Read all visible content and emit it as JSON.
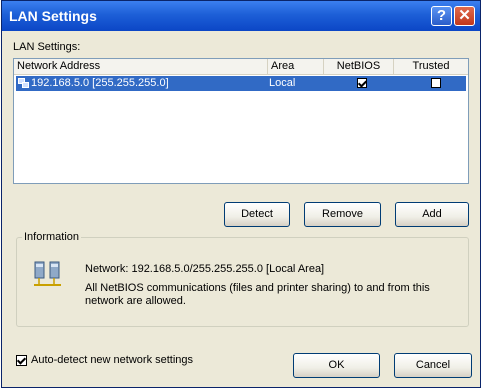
{
  "window": {
    "title": "LAN Settings"
  },
  "lan_settings_label": "LAN Settings:",
  "list": {
    "columns": [
      "Network Address",
      "Area",
      "NetBIOS",
      "Trusted"
    ],
    "rows": [
      {
        "address": "192.168.5.0 [255.255.255.0]",
        "area": "Local",
        "netbios": true,
        "trusted": false
      }
    ]
  },
  "buttons": {
    "detect": "Detect",
    "remove": "Remove",
    "add": "Add",
    "ok": "OK",
    "cancel": "Cancel"
  },
  "information": {
    "legend": "Information",
    "network_text": "Network: 192.168.5.0/255.255.255.0 [Local Area]",
    "netbios_text": "All NetBIOS communications (files and printer sharing) to and from this network are allowed."
  },
  "auto_detect": {
    "label": "Auto-detect new network settings",
    "checked": true
  },
  "icons": [
    "network-icon",
    "help-icon",
    "close-icon",
    "computers-icon"
  ],
  "colors": {
    "titlebar": "#0b46c6",
    "selection": "#316ac5",
    "dialog_bg": "#ece9d8"
  }
}
